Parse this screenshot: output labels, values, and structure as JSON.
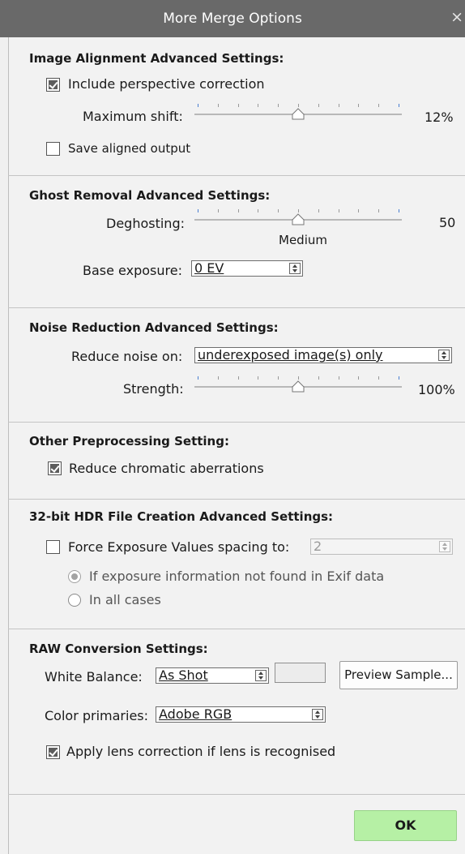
{
  "window": {
    "title": "More Merge Options",
    "close_glyph": "×"
  },
  "alignment": {
    "heading": "Image Alignment Advanced Settings:",
    "perspective_label": "Include perspective correction",
    "perspective_checked": true,
    "max_shift_label": "Maximum shift:",
    "max_shift_value": "12%",
    "max_shift_fraction": 0.5,
    "save_aligned_label": "Save aligned output",
    "save_aligned_checked": false
  },
  "ghost": {
    "heading": "Ghost Removal Advanced Settings:",
    "deghosting_label": "Deghosting:",
    "deghosting_value": "50",
    "deghosting_caption": "Medium",
    "deghosting_fraction": 0.5,
    "base_exposure_label": "Base exposure:",
    "base_exposure_value": "0 EV"
  },
  "noise": {
    "heading": "Noise Reduction Advanced Settings:",
    "reduce_on_label": "Reduce noise on:",
    "reduce_on_value": "underexposed image(s) only",
    "strength_label": "Strength:",
    "strength_value": "100%",
    "strength_fraction": 0.5
  },
  "preprocessing": {
    "heading": "Other Preprocessing Setting:",
    "chromatic_label": "Reduce chromatic aberrations",
    "chromatic_checked": true
  },
  "hdr": {
    "heading": "32-bit HDR File Creation Advanced Settings:",
    "force_label": "Force Exposure Values spacing to:",
    "force_checked": false,
    "force_value": "2",
    "radio_exif_label": "If exposure information not found in Exif data",
    "radio_all_label": "In all cases",
    "radio_selected": "exif"
  },
  "raw": {
    "heading": "RAW Conversion Settings:",
    "white_balance_label": "White Balance:",
    "white_balance_value": "As Shot",
    "preview_button": "Preview Sample...",
    "color_primaries_label": "Color primaries:",
    "color_primaries_value": "Adobe RGB",
    "lens_label": "Apply lens correction if lens is recognised",
    "lens_checked": true
  },
  "footer": {
    "ok_label": "OK"
  },
  "colors": {
    "titlebar": "#696969",
    "ok_button": "#b6f0a5",
    "tick_blue": "#4a7fd0"
  }
}
